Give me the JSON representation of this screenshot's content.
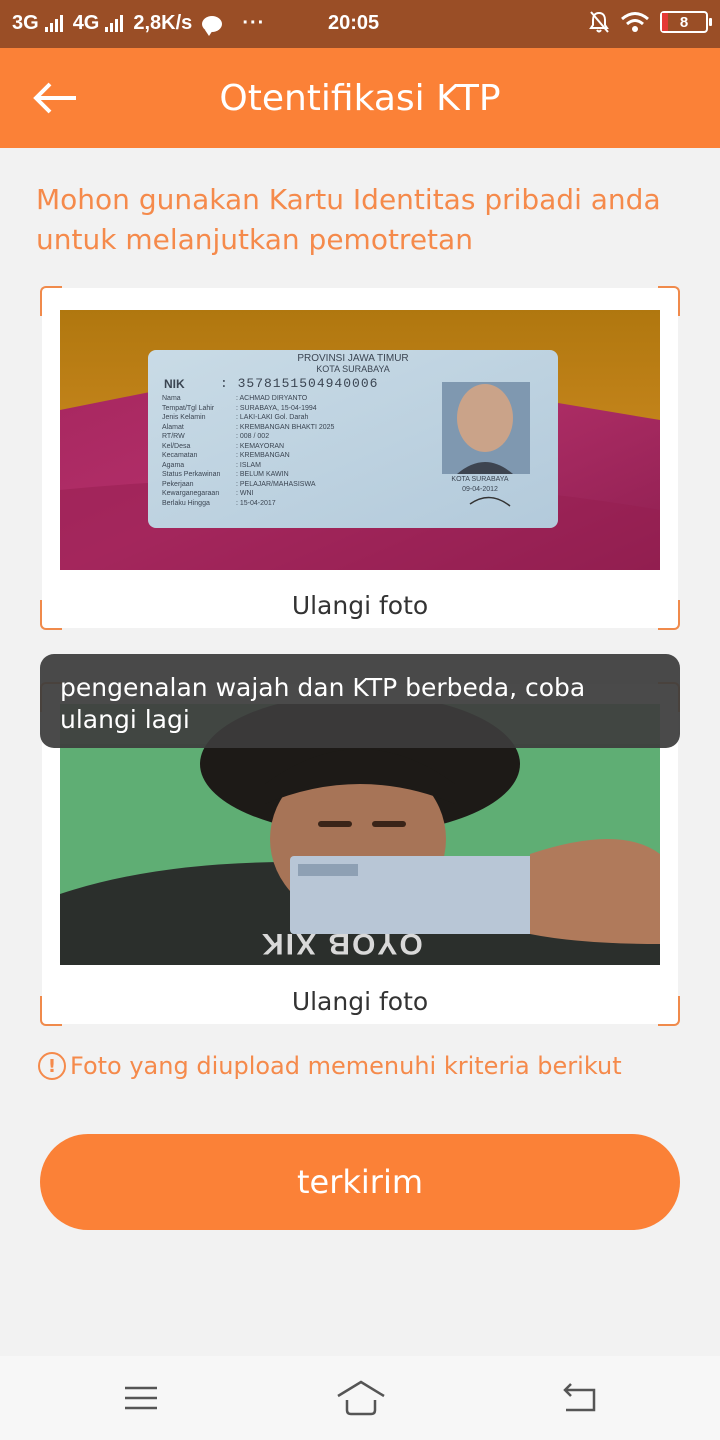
{
  "status_bar": {
    "network1": "3G",
    "network2": "4G",
    "speed": "2,8K/s",
    "more": "···",
    "time": "20:05",
    "battery": "8"
  },
  "header": {
    "title": "Otentifikasi KTP"
  },
  "instruction": "Mohon gunakan Kartu Identitas pribadi anda untuk melanjutkan pemotretan",
  "ktp_photo": {
    "province": "PROVINSI JAWA TIMUR",
    "city": "KOTA SURABAYA",
    "nik_label": "NIK",
    "nik": ": 3578151504940006",
    "fields": [
      [
        "Nama",
        ": ACHMAD DIRYANTO"
      ],
      [
        "Tempat/Tgl Lahir",
        ": SURABAYA, 15-04-1994"
      ],
      [
        "Jenis Kelamin",
        ": LAKI-LAKI    Gol. Darah"
      ],
      [
        "Alamat",
        ": KREMBANGAN BHAKTI 2025"
      ],
      [
        "RT/RW",
        ": 008 / 002"
      ],
      [
        "Kel/Desa",
        ": KEMAYORAN"
      ],
      [
        "Kecamatan",
        ": KREMBANGAN"
      ],
      [
        "Agama",
        ": ISLAM"
      ],
      [
        "Status Perkawinan",
        ": BELUM KAWIN"
      ],
      [
        "Pekerjaan",
        ": PELAJAR/MAHASISWA"
      ],
      [
        "Kewarganegaraan",
        ": WNI"
      ],
      [
        "Berlaku Hingga",
        ": 15-04-2017"
      ]
    ],
    "sign_city": "KOTA SURABAYA",
    "sign_date": "09-04-2012"
  },
  "selfie_photo": {
    "shirt_text": "OYOB XIK"
  },
  "retake_label": "Ulangi foto",
  "toast": "pengenalan wajah dan KTP berbeda, coba ulangi lagi",
  "criteria_note": "Foto yang diupload memenuhi kriteria berikut",
  "info_icon_glyph": "!",
  "submit_label": "terkirim",
  "colors": {
    "accent": "#fb8137",
    "status_bar": "#9a4e26",
    "note_text": "#f58a4b"
  }
}
